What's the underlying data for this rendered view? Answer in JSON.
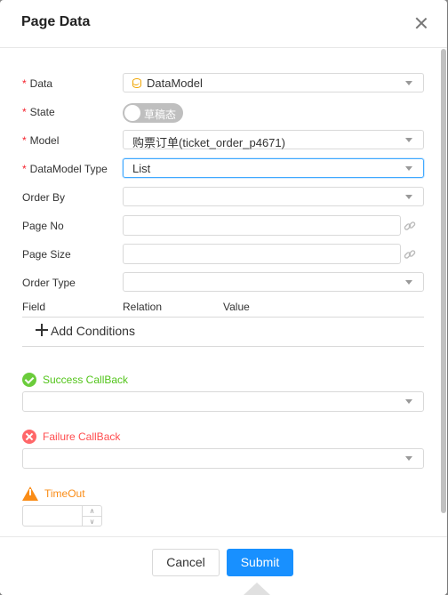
{
  "dialog": {
    "title": "Page Data",
    "close_icon": "close-icon"
  },
  "form": {
    "data": {
      "label": "Data",
      "value": "DataModel",
      "icon": "database-icon"
    },
    "state": {
      "label": "State",
      "toggle_text": "草稿态",
      "on": false
    },
    "model": {
      "label": "Model",
      "value": "购票订单(ticket_order_p4671)"
    },
    "datamodel_type": {
      "label": "DataModel Type",
      "value": "List"
    },
    "order_by": {
      "label": "Order By",
      "value": ""
    },
    "page_no": {
      "label": "Page No",
      "value": ""
    },
    "page_size": {
      "label": "Page Size",
      "value": ""
    },
    "order_type": {
      "label": "Order Type",
      "value": ""
    },
    "required_mark": "*"
  },
  "conditions": {
    "columns": [
      "Field",
      "Relation",
      "Value"
    ],
    "add_label": "Add Conditions"
  },
  "callbacks": {
    "success": {
      "label": "Success CallBack",
      "color": "#52c41a",
      "value": ""
    },
    "failure": {
      "label": "Failure CallBack",
      "color": "#ff4d4f",
      "value": ""
    },
    "timeout": {
      "label": "TimeOut",
      "color": "#fa8c16",
      "value": ""
    }
  },
  "footer": {
    "cancel_label": "Cancel",
    "submit_label": "Submit",
    "accent": "#1890ff"
  }
}
